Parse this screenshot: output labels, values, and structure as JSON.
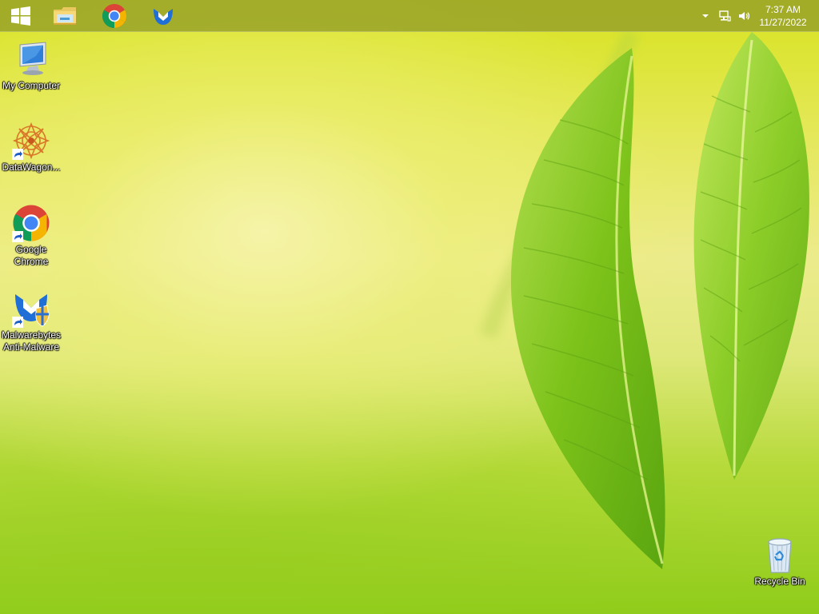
{
  "taskbar": {
    "start_label": "Start",
    "pinned": [
      {
        "name": "File Explorer",
        "icon": "file-explorer-icon"
      },
      {
        "name": "Google Chrome",
        "icon": "chrome-icon"
      },
      {
        "name": "Malwarebytes",
        "icon": "malwarebytes-icon"
      }
    ],
    "tray": {
      "icons": [
        "chevron-up-icon",
        "network-icon",
        "volume-icon"
      ],
      "time": "7:37 AM",
      "date": "11/27/2022"
    }
  },
  "desktop": {
    "icons": [
      {
        "label": "My Computer",
        "icon": "computer-icon"
      },
      {
        "label": "DataWagon...",
        "icon": "datawagon-icon",
        "shortcut": true
      },
      {
        "label": "Google\nChrome",
        "icon": "chrome-icon",
        "shortcut": true
      },
      {
        "label": "Malwarebytes\nAnti-Malware",
        "icon": "malwarebytes-icon",
        "shortcut": true
      },
      {
        "label": "Recycle Bin",
        "icon": "recycle-bin-icon"
      }
    ]
  },
  "colors": {
    "taskbar": "#96a028",
    "wallpaper_top": "#d8e31f",
    "wallpaper_bottom": "#8fcc1a",
    "leaf": "#7fc21a"
  }
}
